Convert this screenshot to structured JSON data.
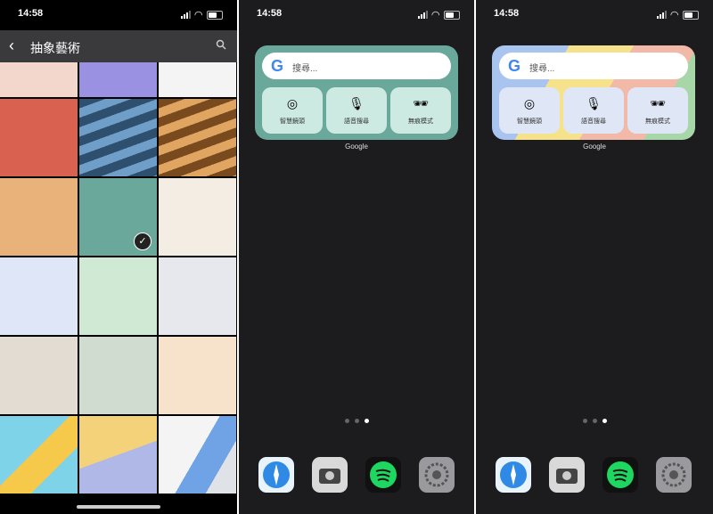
{
  "status": {
    "time": "14:58"
  },
  "wallpaper_picker": {
    "title": "抽象藝術",
    "back_icon": "chevron-left-icon",
    "search_icon": "search-icon",
    "selected_tile": 4
  },
  "widget": {
    "search_placeholder": "搜尋...",
    "google_letter": "G",
    "buttons": [
      {
        "label": "智慧鏡頭",
        "icon": "lens-icon"
      },
      {
        "label": "語音搜尋",
        "icon": "mic-icon"
      },
      {
        "label": "無痕模式",
        "icon": "incognito-icon"
      }
    ],
    "name": "Google"
  },
  "dock": [
    "safari-icon",
    "camera-icon",
    "spotify-icon",
    "settings-icon"
  ],
  "page_dots": {
    "count": 3,
    "active": 2
  }
}
